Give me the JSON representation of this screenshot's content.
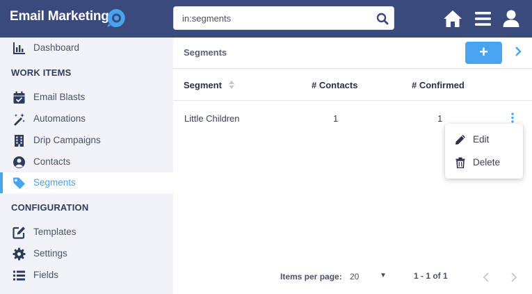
{
  "header": {
    "app_title": "Email Marketing",
    "search_value": "in:segments",
    "icons": [
      "logo-icon",
      "search-icon",
      "home-icon",
      "menu-icon",
      "user-icon"
    ]
  },
  "sidebar": {
    "top_item": {
      "label": "Dashboard",
      "icon": "chart-icon"
    },
    "section_work": "WORK ITEMS",
    "work_items": [
      {
        "label": "Email Blasts",
        "icon": "calendar-check-icon"
      },
      {
        "label": "Automations",
        "icon": "magic-wand-icon"
      },
      {
        "label": "Drip Campaigns",
        "icon": "building-icon"
      },
      {
        "label": "Contacts",
        "icon": "user-circle-icon"
      },
      {
        "label": "Segments",
        "icon": "tag-icon",
        "active": true
      }
    ],
    "section_config": "CONFIGURATION",
    "config_items": [
      {
        "label": "Templates",
        "icon": "edit-icon"
      },
      {
        "label": "Settings",
        "icon": "gear-icon"
      },
      {
        "label": "Fields",
        "icon": "list-icon"
      }
    ]
  },
  "main": {
    "title": "Segments",
    "add_label": "+",
    "columns": [
      "Segment",
      "# Contacts",
      "# Confirmed"
    ],
    "rows": [
      {
        "segment": "Little Children",
        "contacts": "1",
        "confirmed": "1"
      }
    ],
    "row_menu": {
      "edit": "Edit",
      "delete": "Delete"
    },
    "footer": {
      "items_per_page_label": "Items per page:",
      "items_per_page_value": "20",
      "range": "1 - 1 of 1"
    }
  },
  "colors": {
    "header": "#3b4a7c",
    "accent": "#4aa3ee",
    "sidebar": "#f1f3f8"
  }
}
